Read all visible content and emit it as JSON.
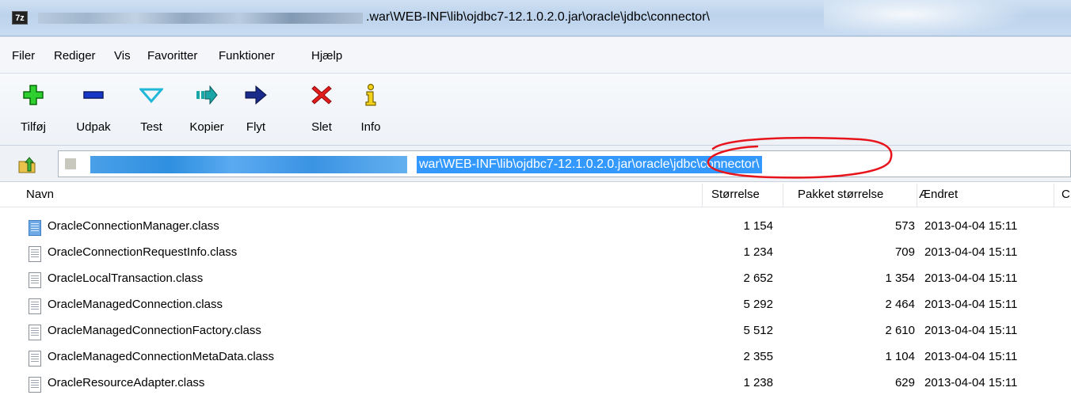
{
  "window": {
    "app_icon_text": "7z",
    "title_visible": ".war\\WEB-INF\\lib\\ojdbc7-12.1.0.2.0.jar\\oracle\\jdbc\\connector\\"
  },
  "menu": [
    "Filer",
    "Rediger",
    "Vis",
    "Favoritter",
    "Funktioner",
    "Hjælp"
  ],
  "toolbar": [
    {
      "label": "Tilføj",
      "icon": "add-icon"
    },
    {
      "label": "Udpak",
      "icon": "extract-icon"
    },
    {
      "label": "Test",
      "icon": "test-icon"
    },
    {
      "label": "Kopier",
      "icon": "copy-icon"
    },
    {
      "label": "Flyt",
      "icon": "move-icon"
    },
    {
      "label": "Slet",
      "icon": "delete-icon"
    },
    {
      "label": "Info",
      "icon": "info-icon"
    }
  ],
  "address": {
    "path_selected": "war\\WEB-INF\\lib\\ojdbc7-12.1.0.2.0.jar\\oracle\\jdbc\\connector\\"
  },
  "columns": {
    "name": "Navn",
    "size": "Størrelse",
    "packed": "Pakket størrelse",
    "modified": "Ændret",
    "next": "C"
  },
  "files": [
    {
      "name": "OracleConnectionManager.class",
      "size": "1 154",
      "packed": "573",
      "modified": "2013-04-04 15:11",
      "selected_icon": true
    },
    {
      "name": "OracleConnectionRequestInfo.class",
      "size": "1 234",
      "packed": "709",
      "modified": "2013-04-04 15:11",
      "selected_icon": false
    },
    {
      "name": "OracleLocalTransaction.class",
      "size": "2 652",
      "packed": "1 354",
      "modified": "2013-04-04 15:11",
      "selected_icon": false
    },
    {
      "name": "OracleManagedConnection.class",
      "size": "5 292",
      "packed": "2 464",
      "modified": "2013-04-04 15:11",
      "selected_icon": false
    },
    {
      "name": "OracleManagedConnectionFactory.class",
      "size": "5 512",
      "packed": "2 610",
      "modified": "2013-04-04 15:11",
      "selected_icon": false
    },
    {
      "name": "OracleManagedConnectionMetaData.class",
      "size": "2 355",
      "packed": "1 104",
      "modified": "2013-04-04 15:11",
      "selected_icon": false
    },
    {
      "name": "OracleResourceAdapter.class",
      "size": "1 238",
      "packed": "629",
      "modified": "2013-04-04 15:11",
      "selected_icon": false
    }
  ],
  "colors": {
    "selection": "#3399ff",
    "annotation": "#e8141b"
  }
}
